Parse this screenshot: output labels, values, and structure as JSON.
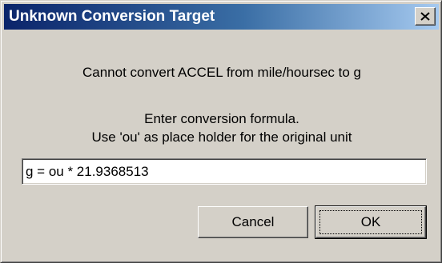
{
  "window": {
    "title": "Unknown Conversion Target",
    "close_icon": "close-icon"
  },
  "message": {
    "line1": "Cannot convert ACCEL from mile/hoursec to g",
    "line2": "Enter conversion formula.",
    "line3": "Use 'ou' as place holder for the original unit"
  },
  "formula": {
    "value": "g = ou * 21.9368513"
  },
  "buttons": {
    "cancel_label": "Cancel",
    "ok_label": "OK"
  },
  "colors": {
    "titlebar_start": "#0a246a",
    "titlebar_end": "#a6caf0",
    "face": "#d4d0c8"
  }
}
